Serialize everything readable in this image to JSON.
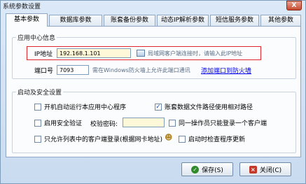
{
  "window": {
    "title": "系统参数设置",
    "close_glyph": "X"
  },
  "tabs": [
    {
      "label": "基本参数",
      "active": true
    },
    {
      "label": "数据库参数",
      "active": false
    },
    {
      "label": "账套备份参数",
      "active": false
    },
    {
      "label": "动态IP解析参数",
      "active": false
    },
    {
      "label": "短信服务参数",
      "active": false
    },
    {
      "label": "其他参数",
      "active": false
    }
  ],
  "app_center": {
    "group_title": "应用中心信息",
    "ip_label": "IP地址",
    "ip_value": "192.168.1.101",
    "ip_note": "局域网客户端连接时，请输入此IP地址",
    "port_label": "端口号",
    "port_value": "7093",
    "port_note": "需在Windows防火墙上允许此端口通讯",
    "add_firewall_link": "添加端口到防火墙"
  },
  "startup_security": {
    "group_title": "启动及安全设置",
    "autostart_label": "开机自动运行本应用中心程序",
    "autostart_checked": false,
    "relative_path_label": "账套数据文件路径使用相对路径",
    "relative_path_checked": true,
    "enable_security_label": "启用安全验证",
    "enable_security_checked": false,
    "verify_password_label": "校验密码:",
    "verify_password_value": "",
    "single_client_label": "同一操作员只能登录一个客户端",
    "single_client_checked": false,
    "mac_list_label": "只允许列表中的客户端登录(根据网卡地址)",
    "mac_list_checked": false,
    "check_update_label": "启动时检查程序更新",
    "check_update_checked": false
  },
  "buttons": {
    "save": "保存(S)",
    "close": "关闭(C)"
  },
  "colors": {
    "highlight_border": "#e0242b",
    "link": "#0000ee",
    "save_icon": "#2f8a2a",
    "close_icon": "#c33a2a"
  }
}
